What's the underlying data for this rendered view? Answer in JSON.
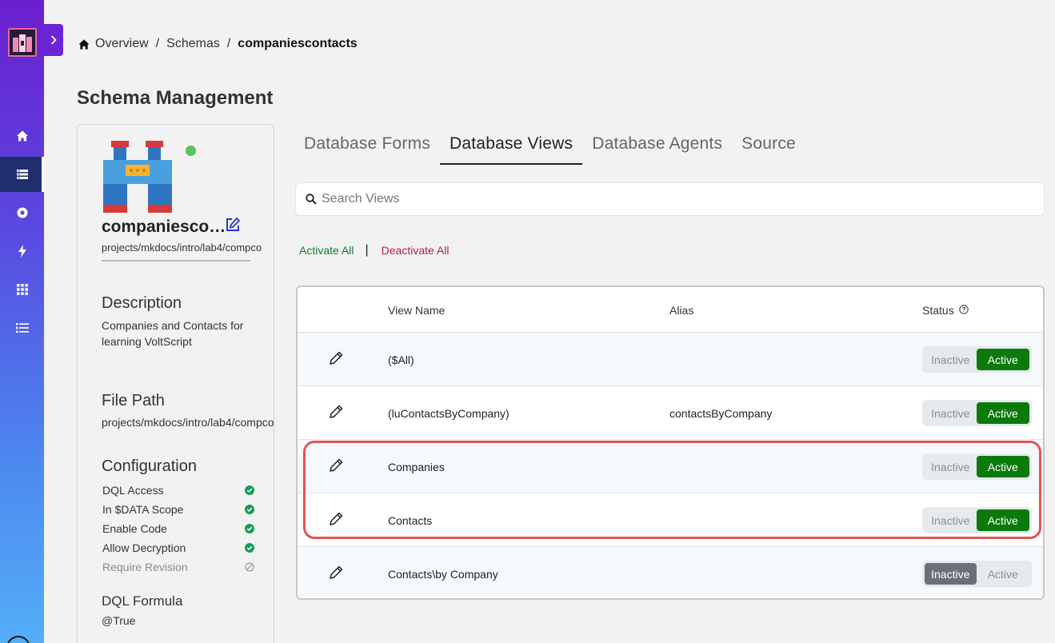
{
  "breadcrumb": {
    "home": "Overview",
    "schemas": "Schemas",
    "current": "companiescontacts"
  },
  "page_title": "Schema Management",
  "schema": {
    "name": "companiesco…",
    "path": "projects/mkdocs/intro/lab4/compco",
    "status_color": "#5ac45a"
  },
  "description": {
    "title": "Description",
    "line1": "Companies and Contacts for",
    "line2": "learning VoltScript"
  },
  "file_path": {
    "title": "File Path",
    "value": "projects/mkdocs/intro/lab4/compco"
  },
  "configuration": {
    "title": "Configuration",
    "items": [
      {
        "label": "DQL Access",
        "enabled": true
      },
      {
        "label": "In $DATA Scope",
        "enabled": true
      },
      {
        "label": "Enable Code",
        "enabled": true
      },
      {
        "label": "Allow Decryption",
        "enabled": true
      },
      {
        "label": "Require Revision",
        "enabled": false
      }
    ]
  },
  "dql_formula": {
    "title": "DQL Formula",
    "value": "@True"
  },
  "tabs": [
    "Database Forms",
    "Database Views",
    "Database Agents",
    "Source"
  ],
  "active_tab": "Database Views",
  "search": {
    "placeholder": "Search Views"
  },
  "bulk": {
    "activate": "Activate All",
    "separator": "|",
    "deactivate": "Deactivate All"
  },
  "table": {
    "headers": {
      "view_name": "View Name",
      "alias": "Alias",
      "status": "Status"
    },
    "toggle_labels": {
      "inactive": "Inactive",
      "active": "Active"
    },
    "rows": [
      {
        "view_name": "($All)",
        "alias": "",
        "active": true
      },
      {
        "view_name": "(luContactsByCompany)",
        "alias": "contactsByCompany",
        "active": true
      },
      {
        "view_name": "Companies",
        "alias": "",
        "active": true
      },
      {
        "view_name": "Contacts",
        "alias": "",
        "active": true
      },
      {
        "view_name": "Contacts\\by Company",
        "alias": "",
        "active": false
      }
    ]
  },
  "colors": {
    "active": "#0b7a0b",
    "inactive_selected": "#6b7078",
    "highlight": "#e05555",
    "check": "#1a9a5a"
  }
}
